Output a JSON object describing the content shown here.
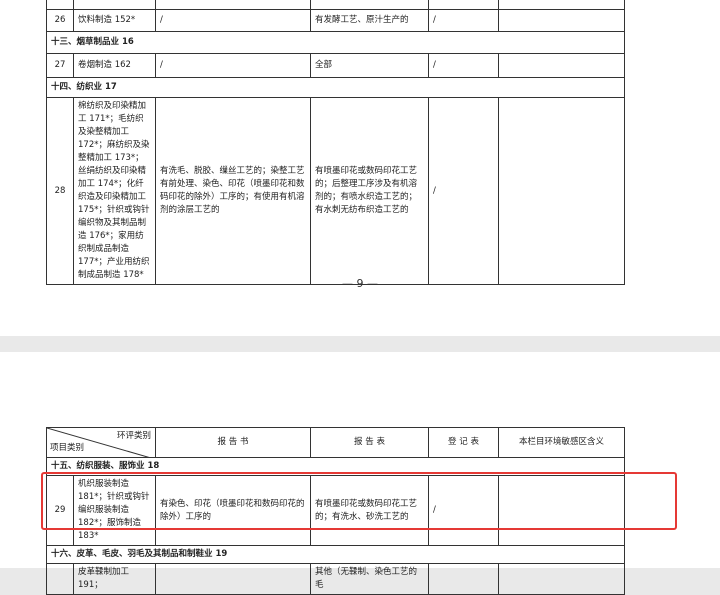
{
  "page1": {
    "row26": {
      "no": "26",
      "category": "饮料制造 152*",
      "book": "/",
      "form": "有发酵工艺、原汁生产的",
      "reg": "/",
      "sens": ""
    },
    "sec13": "十三、烟草制品业 16",
    "row27": {
      "no": "27",
      "category": "卷烟制造 162",
      "book": "/",
      "form": "全部",
      "reg": "/",
      "sens": ""
    },
    "sec14": "十四、纺织业 17",
    "row28": {
      "no": "28",
      "category": "棉纺织及印染精加工 171*；毛纺织及染整精加工 172*；麻纺织及染整精加工 173*；丝绢纺织及印染精加工 174*；化纤织造及印染精加工 175*；针织或钩针编织物及其制品制造 176*；家用纺织制成品制造 177*；产业用纺织制成品制造 178*",
      "book": "有洗毛、脱胶、缫丝工艺的；染整工艺有前处理、染色、印花（喷墨印花和数码印花的除外）工序的；有使用有机溶剂的涂层工艺的",
      "form": "有喷墨印花或数码印花工艺的；后整理工序涉及有机溶剂的；有喷水织造工艺的；有水刺无纺布织造工艺的",
      "reg": "/",
      "sens": ""
    },
    "page_number": "— 9 —"
  },
  "page2": {
    "header": {
      "corner_top": "环评类别",
      "corner_bottom": "项目类别",
      "book": "报 告 书",
      "form": "报 告 表",
      "reg": "登 记 表",
      "sens": "本栏目环境敏感区含义"
    },
    "sec15": "十五、纺织服装、服饰业 18",
    "row29": {
      "no": "29",
      "category": "机织服装制造 181*；针织或钩针编织服装制造 182*；服饰制造 183*",
      "book": "有染色、印花（喷墨印花和数码印花的除外）工序的",
      "form": "有喷墨印花或数码印花工艺的；有洗水、砂洗工艺的",
      "reg": "/",
      "sens": ""
    },
    "sec16": "十六、皮革、毛皮、羽毛及其制品和制鞋业 19",
    "row30": {
      "no": "",
      "category": "皮革鞣制加工 191；",
      "book": "",
      "form": "其他（无鞣制、染色工艺的毛",
      "reg": "",
      "sens": ""
    }
  },
  "colors": {
    "highlight": "#e53935",
    "background": "#e9e9e9"
  }
}
